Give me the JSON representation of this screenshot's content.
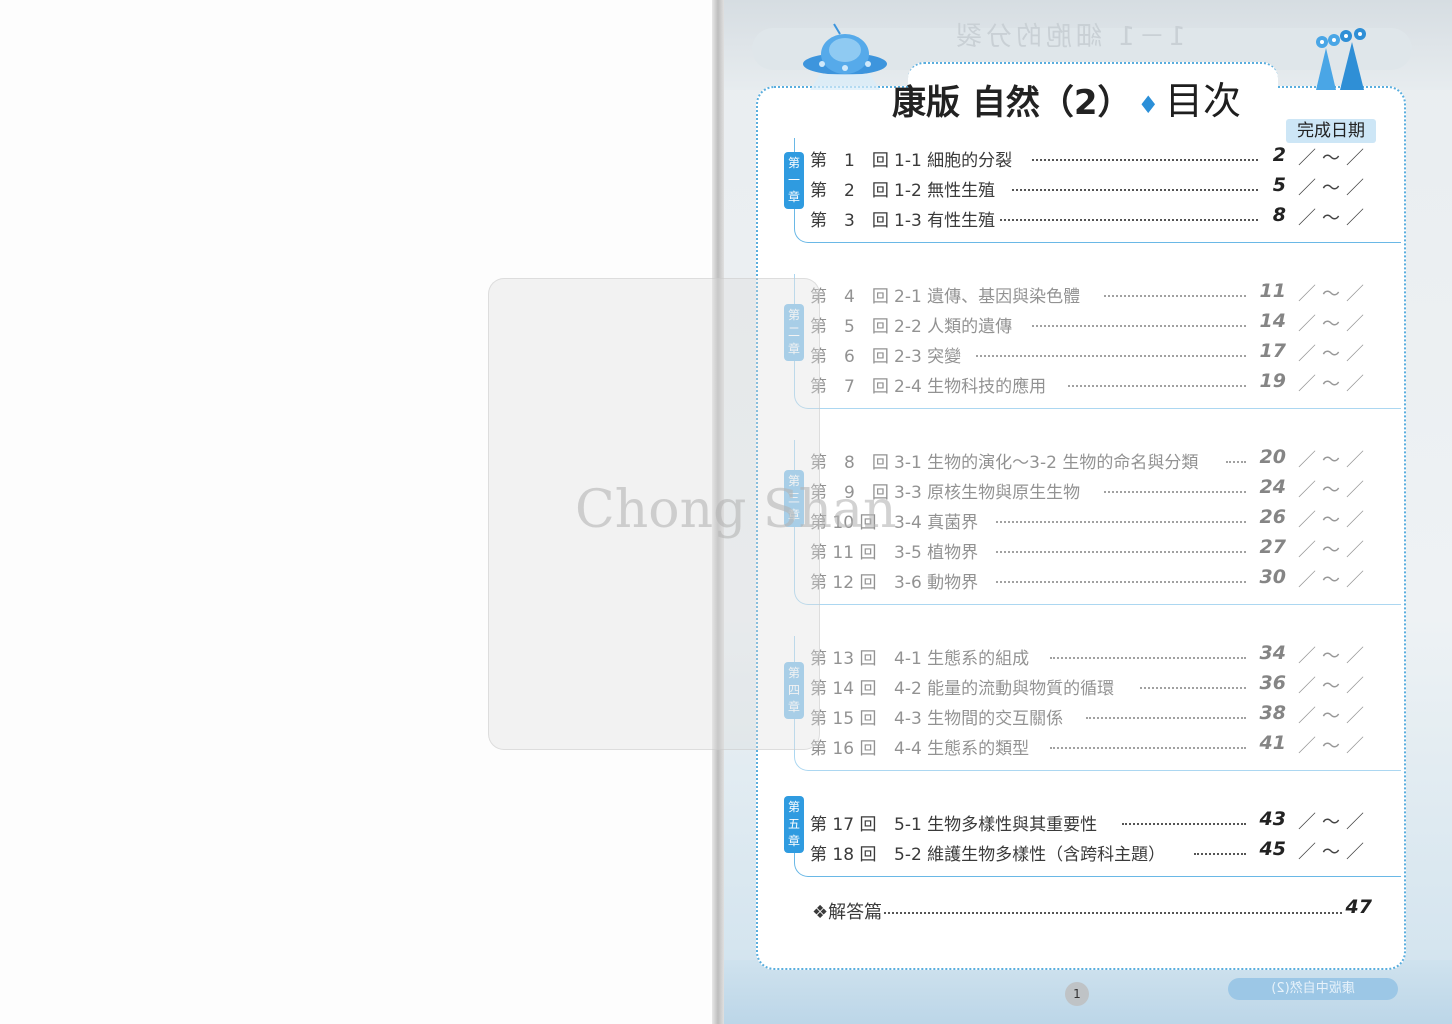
{
  "header": {
    "title_main": "康版 自然（2）",
    "title_diamond": "♦",
    "title_sub": "目次",
    "date_label": "完成日期",
    "mirror_title": "1－1 細胞的分裂"
  },
  "chapters": [
    {
      "badge": "第一章",
      "lessons": [
        {
          "num": "第　1　回",
          "title": "1-1  細胞的分裂",
          "page": "2",
          "date": "／～／"
        },
        {
          "num": "第　2　回",
          "title": "1-2  無性生殖",
          "page": "5",
          "date": "／～／"
        },
        {
          "num": "第　3　回",
          "title": "1-3  有性生殖",
          "page": "8",
          "date": "／～／"
        }
      ]
    },
    {
      "badge": "第二章",
      "lessons": [
        {
          "num": "第　4　回",
          "title": "2-1  遺傳、基因與染色體",
          "page": "11",
          "date": "／～／"
        },
        {
          "num": "第　5　回",
          "title": "2-2  人類的遺傳",
          "page": "14",
          "date": "／～／"
        },
        {
          "num": "第　6　回",
          "title": "2-3  突變",
          "page": "17",
          "date": "／～／"
        },
        {
          "num": "第　7　回",
          "title": "2-4  生物科技的應用",
          "page": "19",
          "date": "／～／"
        }
      ]
    },
    {
      "badge": "第三章",
      "lessons": [
        {
          "num": "第　8　回",
          "title": "3-1  生物的演化～3-2 生物的命名與分類",
          "page": "20",
          "date": "／～／"
        },
        {
          "num": "第　9　回",
          "title": "3-3  原核生物與原生生物",
          "page": "24",
          "date": "／～／"
        },
        {
          "num": "第 10 回",
          "title": "3-4  真菌界",
          "page": "26",
          "date": "／～／"
        },
        {
          "num": "第 11 回",
          "title": "3-5  植物界",
          "page": "27",
          "date": "／～／"
        },
        {
          "num": "第 12 回",
          "title": "3-6  動物界",
          "page": "30",
          "date": "／～／"
        }
      ]
    },
    {
      "badge": "第四章",
      "lessons": [
        {
          "num": "第 13 回",
          "title": "4-1  生態系的組成",
          "page": "34",
          "date": "／～／"
        },
        {
          "num": "第 14 回",
          "title": "4-2  能量的流動與物質的循環",
          "page": "36",
          "date": "／～／"
        },
        {
          "num": "第 15 回",
          "title": "4-3  生物間的交互關係",
          "page": "38",
          "date": "／～／"
        },
        {
          "num": "第 16 回",
          "title": "4-4  生態系的類型",
          "page": "41",
          "date": "／～／"
        }
      ]
    },
    {
      "badge": "第五章",
      "lessons": [
        {
          "num": "第 17 回",
          "title": "5-1  生物多樣性與其重要性",
          "page": "43",
          "date": "／～／"
        },
        {
          "num": "第 18 回",
          "title": "5-2  維護生物多樣性（含跨科主題）",
          "page": "45",
          "date": "／～／"
        }
      ]
    }
  ],
  "answers": {
    "label": "❖解答篇",
    "page": "47"
  },
  "footer": {
    "page_number": "1",
    "mirror_label": "康版中自然(2)"
  },
  "watermark": {
    "text": "Chong Shan"
  },
  "colors": {
    "accent": "#2f9be0",
    "border": "#5aaede",
    "date_bg": "#cde6f6"
  }
}
